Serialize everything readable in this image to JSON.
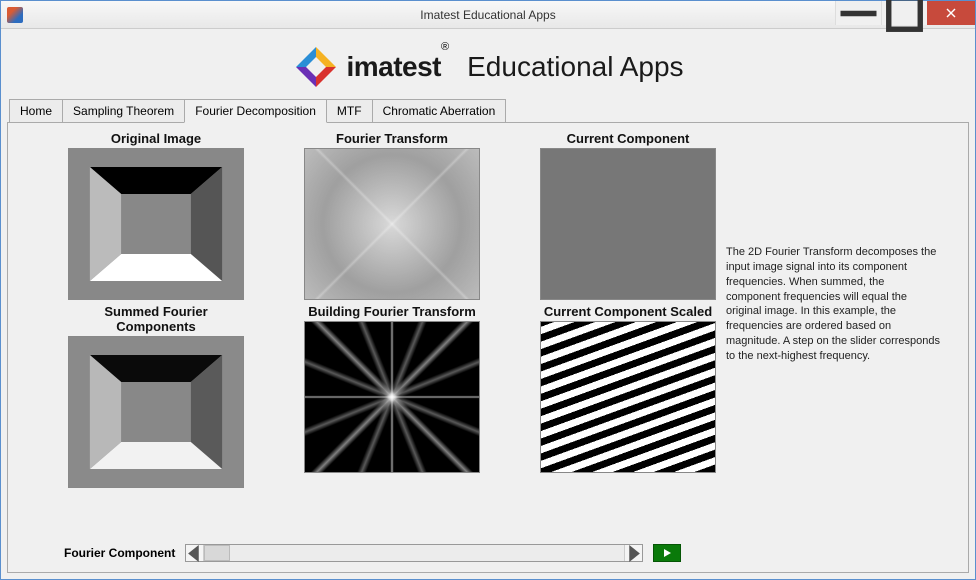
{
  "window": {
    "title": "Imatest Educational Apps"
  },
  "header": {
    "brand": "imatest",
    "reg": "®",
    "subtitle": "Educational Apps"
  },
  "tabs": [
    {
      "label": "Home",
      "active": false
    },
    {
      "label": "Sampling Theorem",
      "active": false
    },
    {
      "label": "Fourier Decomposition",
      "active": true
    },
    {
      "label": "MTF",
      "active": false
    },
    {
      "label": "Chromatic Aberration",
      "active": false
    }
  ],
  "panels": {
    "original": "Original Image",
    "fourier": "Fourier Transform",
    "current": "Current Component",
    "summed": "Summed Fourier Components",
    "building": "Building Fourier Transform",
    "scaled": "Current Component Scaled"
  },
  "description": "The 2D Fourier Transform decomposes the input image signal into its component frequencies. When summed, the component frequencies will equal the original image. In this example, the frequencies are ordered based on magnitude. A step on the slider corresponds to the next-highest frequency.",
  "slider": {
    "label": "Fourier Component"
  }
}
